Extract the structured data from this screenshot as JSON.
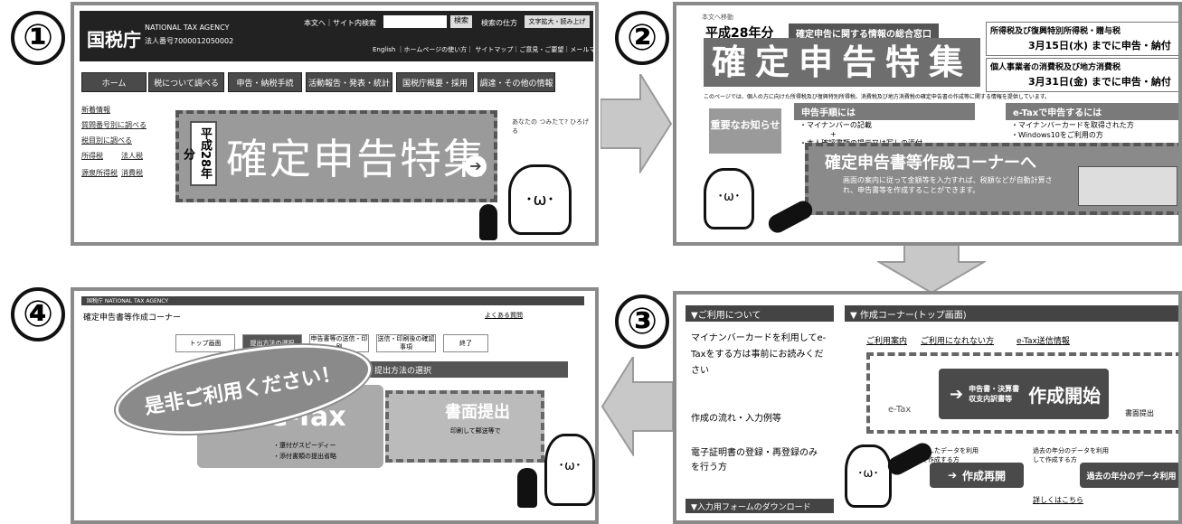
{
  "steps": {
    "s1": "①",
    "s2": "②",
    "s3": "③",
    "s4": "④"
  },
  "p1": {
    "agency_name": "国税庁",
    "agency_en": "NATIONAL TAX AGENCY",
    "corp_num": "法人番号7000012050002",
    "top_links": "本文へ｜サイト内検索",
    "search_btn": "検索",
    "search_help": "検索の仕方",
    "font_btn": "文字拡大・読み上げ",
    "sub_links": "English ｜ホームページの使い方｜ サイトマップ｜ご意見・ご要望｜メールマガジン",
    "nav": [
      "ホーム",
      "税について調べる",
      "申告・納税手続",
      "活動報告・発表・統計",
      "国税庁概要・採用",
      "調達・その他の情報"
    ],
    "side_links": [
      "新着情報",
      "質問番号別に調べる",
      "税目別に調べる"
    ],
    "side_small": [
      "所得税",
      "法人税",
      "源泉所得税",
      "消費税"
    ],
    "banner_year": "平成28年分",
    "banner_title": "確定申告特集",
    "mascot_small": "あなたの つみたて? ひろげる"
  },
  "p2": {
    "skip": "本文へ移動",
    "year": "平成28年分",
    "tag": "確定申告に関する情報の総合窓口",
    "title": "確定申告特集",
    "deadline1_label": "所得税及び復興特別所得税・贈与税",
    "deadline1": "3月15日(水) までに申告・納付",
    "deadline2_label": "個人事業者の消費税及び地方消費税",
    "deadline2": "3月31日(金) までに申告・納付",
    "desc": "このページでは、個人の方に向けた所得税及び復興特別所得税、消費税及び地方消費税の確定申告書の作成等に関する情報を提供しています。",
    "notice": "重要なお知らせ",
    "section1": "申告手順には",
    "section1_items": [
      "・マイナンバーの記載",
      "+",
      "・本人確認書類の提示又は写しの添付"
    ],
    "section2": "e-Taxで申告するには",
    "section2_items": [
      "・マイナンバーカードを取得された方",
      "・Windows10をご利用の方"
    ],
    "corner": "確定申告書等作成コーナーへ",
    "corner_desc": "画面の案内に従って金額等を入力すれば、税額などが自動計算され、申告書等を作成することができます。"
  },
  "p3": {
    "side_header": "▼ご利用について",
    "side_items": [
      "マイナンバーカードを利用してe-Taxをする方は事前にお読みください",
      "作成の流れ・入力例等",
      "電子証明書の登録・再登録のみを行う方"
    ],
    "side_footer": "▼入力用フォームのダウンロード",
    "main_header": "▼ 作成コーナー(トップ画面)",
    "links": [
      "ご利用案内",
      "ご利用になれない方",
      "e-Tax送信情報"
    ],
    "etax": "e-Tax",
    "start_btn_small": "申告書・決算書 収支内訳書等",
    "start_btn": "作成開始",
    "paper": "書面提出",
    "resume_small": "保存したデータを利用して作成する方",
    "resume_btn": "作成再開",
    "past_small": "過去の年分のデータを利用して作成する方",
    "past_btn": "過去の年分のデータ利用",
    "detail": "詳しくはこちら"
  },
  "p4": {
    "agency": "国税庁 NATIONAL TAX AGENCY",
    "title": "確定申告書等作成コーナー",
    "help": "よくある質問",
    "steps": [
      "トップ画面",
      "提出方法の選択",
      "申告書等の送信・印刷",
      "送信・印刷後の確認事項",
      "終了"
    ],
    "section": "提出方法の選択",
    "bubble": "是非ご利用ください！",
    "etax": "e-Tax",
    "etax_sub1": "・還付がスピーディー",
    "etax_sub2": "・添付書類の提出省略",
    "paper": "書面提出",
    "paper_sub": "印刷して郵送等で"
  },
  "colors": {
    "panel_border": "#8a8a8a",
    "arrow": "#c8c8c8",
    "dark": "#4a4a4a",
    "highlight": "#7a7a7a"
  }
}
